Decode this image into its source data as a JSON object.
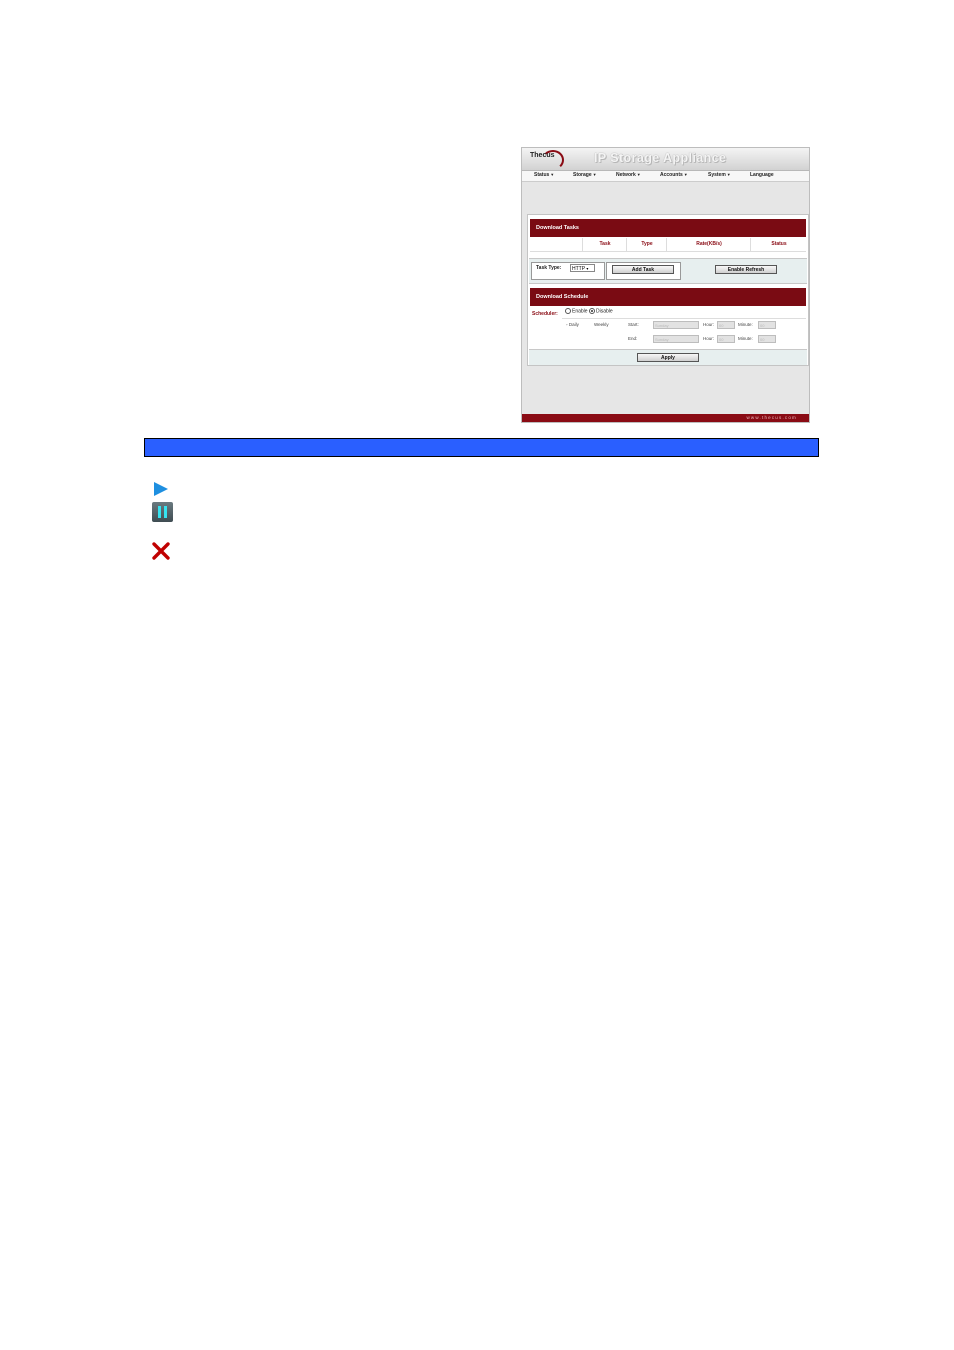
{
  "app": {
    "logo_text": "Thecus",
    "title": "IP Storage Appliance",
    "menu": [
      {
        "label": "Status"
      },
      {
        "label": "Storage"
      },
      {
        "label": "Network"
      },
      {
        "label": "Accounts"
      },
      {
        "label": "System"
      },
      {
        "label": "Language"
      }
    ],
    "download_tasks": {
      "heading": "Download Tasks",
      "columns": [
        "Task",
        "Type",
        "Rate(KB/s)",
        "Status"
      ],
      "task_type_label": "Task Type:",
      "task_type_value": "HTTP",
      "add_task_label": "Add Task",
      "enable_refresh_label": "Enable Refresh"
    },
    "schedule": {
      "heading": "Download Schedule",
      "scheduler_label": "Scheduler:",
      "enable_label": "Enable",
      "disable_label": "Disable",
      "daily_label": "Daily",
      "weekly_label": "Weekly",
      "start_label": "Start:",
      "end_label": "End:",
      "day_value": "Sunday",
      "hour_label": "Hour:",
      "minute_label": "Minute:",
      "hour_value": "00",
      "minute_value": "00",
      "apply_label": "Apply"
    },
    "footer_url": "www.thecus.com"
  },
  "icons": {
    "play": "play-icon",
    "pause": "pause-icon",
    "delete": "delete-icon"
  },
  "colors": {
    "section_header": "#7a0b13",
    "highlight_bar": "#2a5fff",
    "play_icon": "#1e8fe0",
    "delete_icon": "#c00000"
  }
}
